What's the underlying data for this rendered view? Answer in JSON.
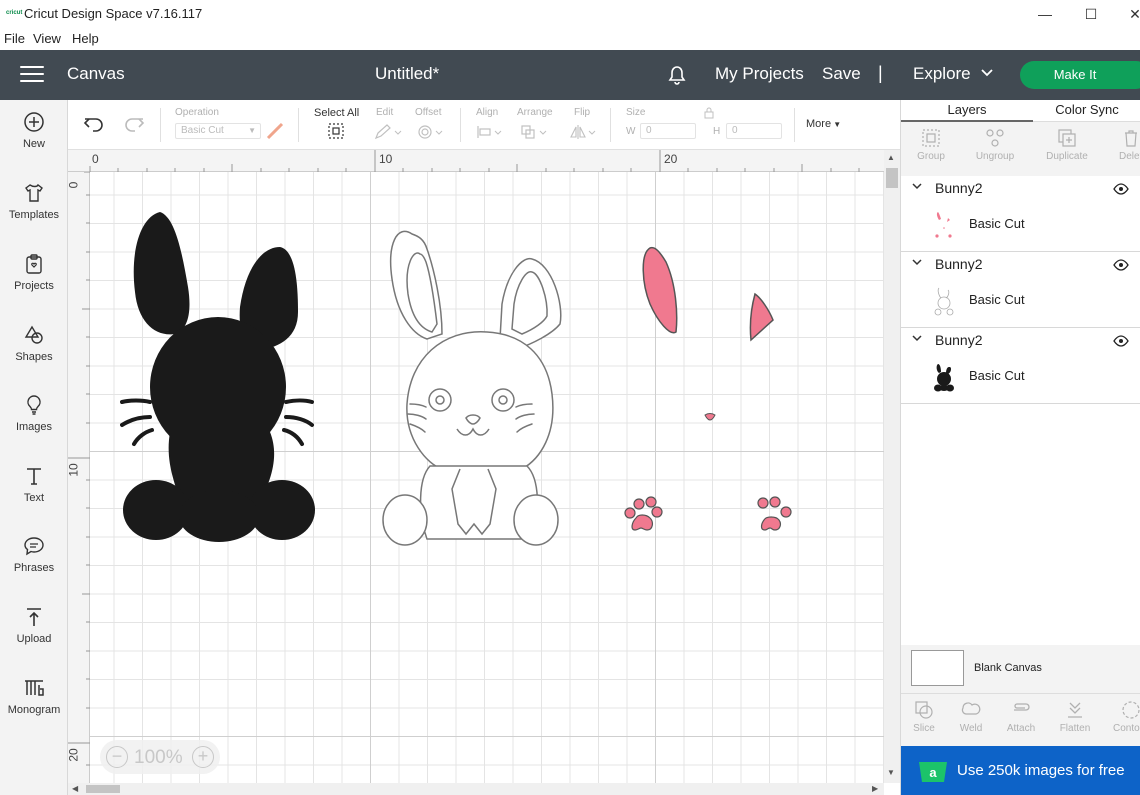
{
  "window": {
    "logo_text": "cricut",
    "title": "Cricut Design Space  v7.16.117",
    "minimize": "—",
    "maximize": "☐",
    "close": "✕"
  },
  "menu": [
    "File",
    "View",
    "Help"
  ],
  "header": {
    "section": "Canvas",
    "doc_title": "Untitled*",
    "my_projects": "My Projects",
    "save": "Save",
    "separator": "|",
    "explore": "Explore",
    "make_it": "Make It",
    "accent": "#0fa05a",
    "bg": "#414a52"
  },
  "left_tools": [
    {
      "label": "New",
      "icon": "plus-circle-icon"
    },
    {
      "label": "Templates",
      "icon": "tshirt-icon"
    },
    {
      "label": "Projects",
      "icon": "clipboard-icon"
    },
    {
      "label": "Shapes",
      "icon": "shapes-icon"
    },
    {
      "label": "Images",
      "icon": "bulb-icon"
    },
    {
      "label": "Text",
      "icon": "text-icon"
    },
    {
      "label": "Phrases",
      "icon": "speech-icon"
    },
    {
      "label": "Upload",
      "icon": "upload-icon"
    },
    {
      "label": "Monogram",
      "icon": "monogram-icon"
    }
  ],
  "toolbar": {
    "operation_label": "Operation",
    "operation_value": "Basic Cut",
    "select_all": "Select All",
    "edit": "Edit",
    "offset": "Offset",
    "align": "Align",
    "arrange": "Arrange",
    "flip": "Flip",
    "size": "Size",
    "w_label": "W",
    "w_value": "0",
    "h_label": "H",
    "h_value": "0",
    "more": "More"
  },
  "rulers": {
    "top": [
      "0",
      "10",
      "20"
    ],
    "left": [
      "0",
      "10",
      "20"
    ]
  },
  "zoom": {
    "minus": "−",
    "level": "100%",
    "plus": "+"
  },
  "layers_panel": {
    "tabs": [
      "Layers",
      "Color Sync"
    ],
    "actions": [
      "Group",
      "Ungroup",
      "Duplicate",
      "Delete"
    ],
    "groups": [
      {
        "name": "Bunny2",
        "item": "Basic Cut",
        "thumb": "pink-parts"
      },
      {
        "name": "Bunny2",
        "item": "Basic Cut",
        "thumb": "outline"
      },
      {
        "name": "Bunny2",
        "item": "Basic Cut",
        "thumb": "silhouette"
      }
    ],
    "blank_canvas": "Blank Canvas",
    "bottom_actions": [
      "Slice",
      "Weld",
      "Attach",
      "Flatten",
      "Contour"
    ],
    "promo": "Use 250k images for free",
    "promo_color": "#0d63c8"
  }
}
